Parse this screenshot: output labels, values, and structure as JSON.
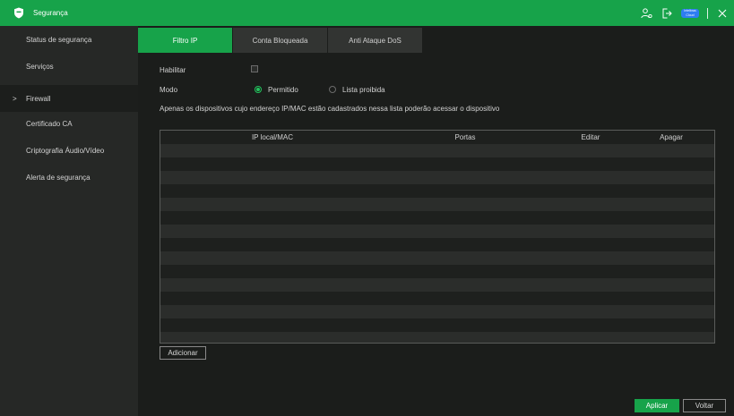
{
  "colors": {
    "accent": "#17a34a",
    "background": "#1b1d1b",
    "sidebar": "#262826"
  },
  "header": {
    "title": "Segurança",
    "icons": [
      "shield-icon",
      "user-settings-icon",
      "logout-icon",
      "cloud-icon",
      "close-icon"
    ],
    "cloud_badge": "Intelbras Cloud"
  },
  "sidebar": {
    "items": [
      {
        "label": "Status de segurança",
        "active": false
      },
      {
        "label": "Serviços",
        "active": false
      },
      {
        "label": "Firewall",
        "active": true
      },
      {
        "label": "Certificado CA",
        "active": false
      },
      {
        "label": "Criptografia Áudio/Vídeo",
        "active": false
      },
      {
        "label": "Alerta de segurança",
        "active": false
      }
    ],
    "chevron": ">"
  },
  "tabs": [
    {
      "label": "Filtro IP",
      "active": true
    },
    {
      "label": "Conta Bloqueada",
      "active": false
    },
    {
      "label": "Anti Ataque DoS",
      "active": false
    }
  ],
  "form": {
    "enable_label": "Habilitar",
    "enable_checked": false,
    "mode_label": "Modo",
    "mode_options": [
      {
        "label": "Permitido",
        "selected": true
      },
      {
        "label": "Lista proibida",
        "selected": false
      }
    ],
    "description": "Apenas os dispositivos cujo endereço IP/MAC estão cadastrados nessa lista poderão acessar o dispositivo"
  },
  "table": {
    "columns": [
      "IP local/MAC",
      "Portas",
      "Editar",
      "Apagar"
    ],
    "rows": []
  },
  "buttons": {
    "add": "Adicionar",
    "apply": "Aplicar",
    "back": "Voltar"
  }
}
